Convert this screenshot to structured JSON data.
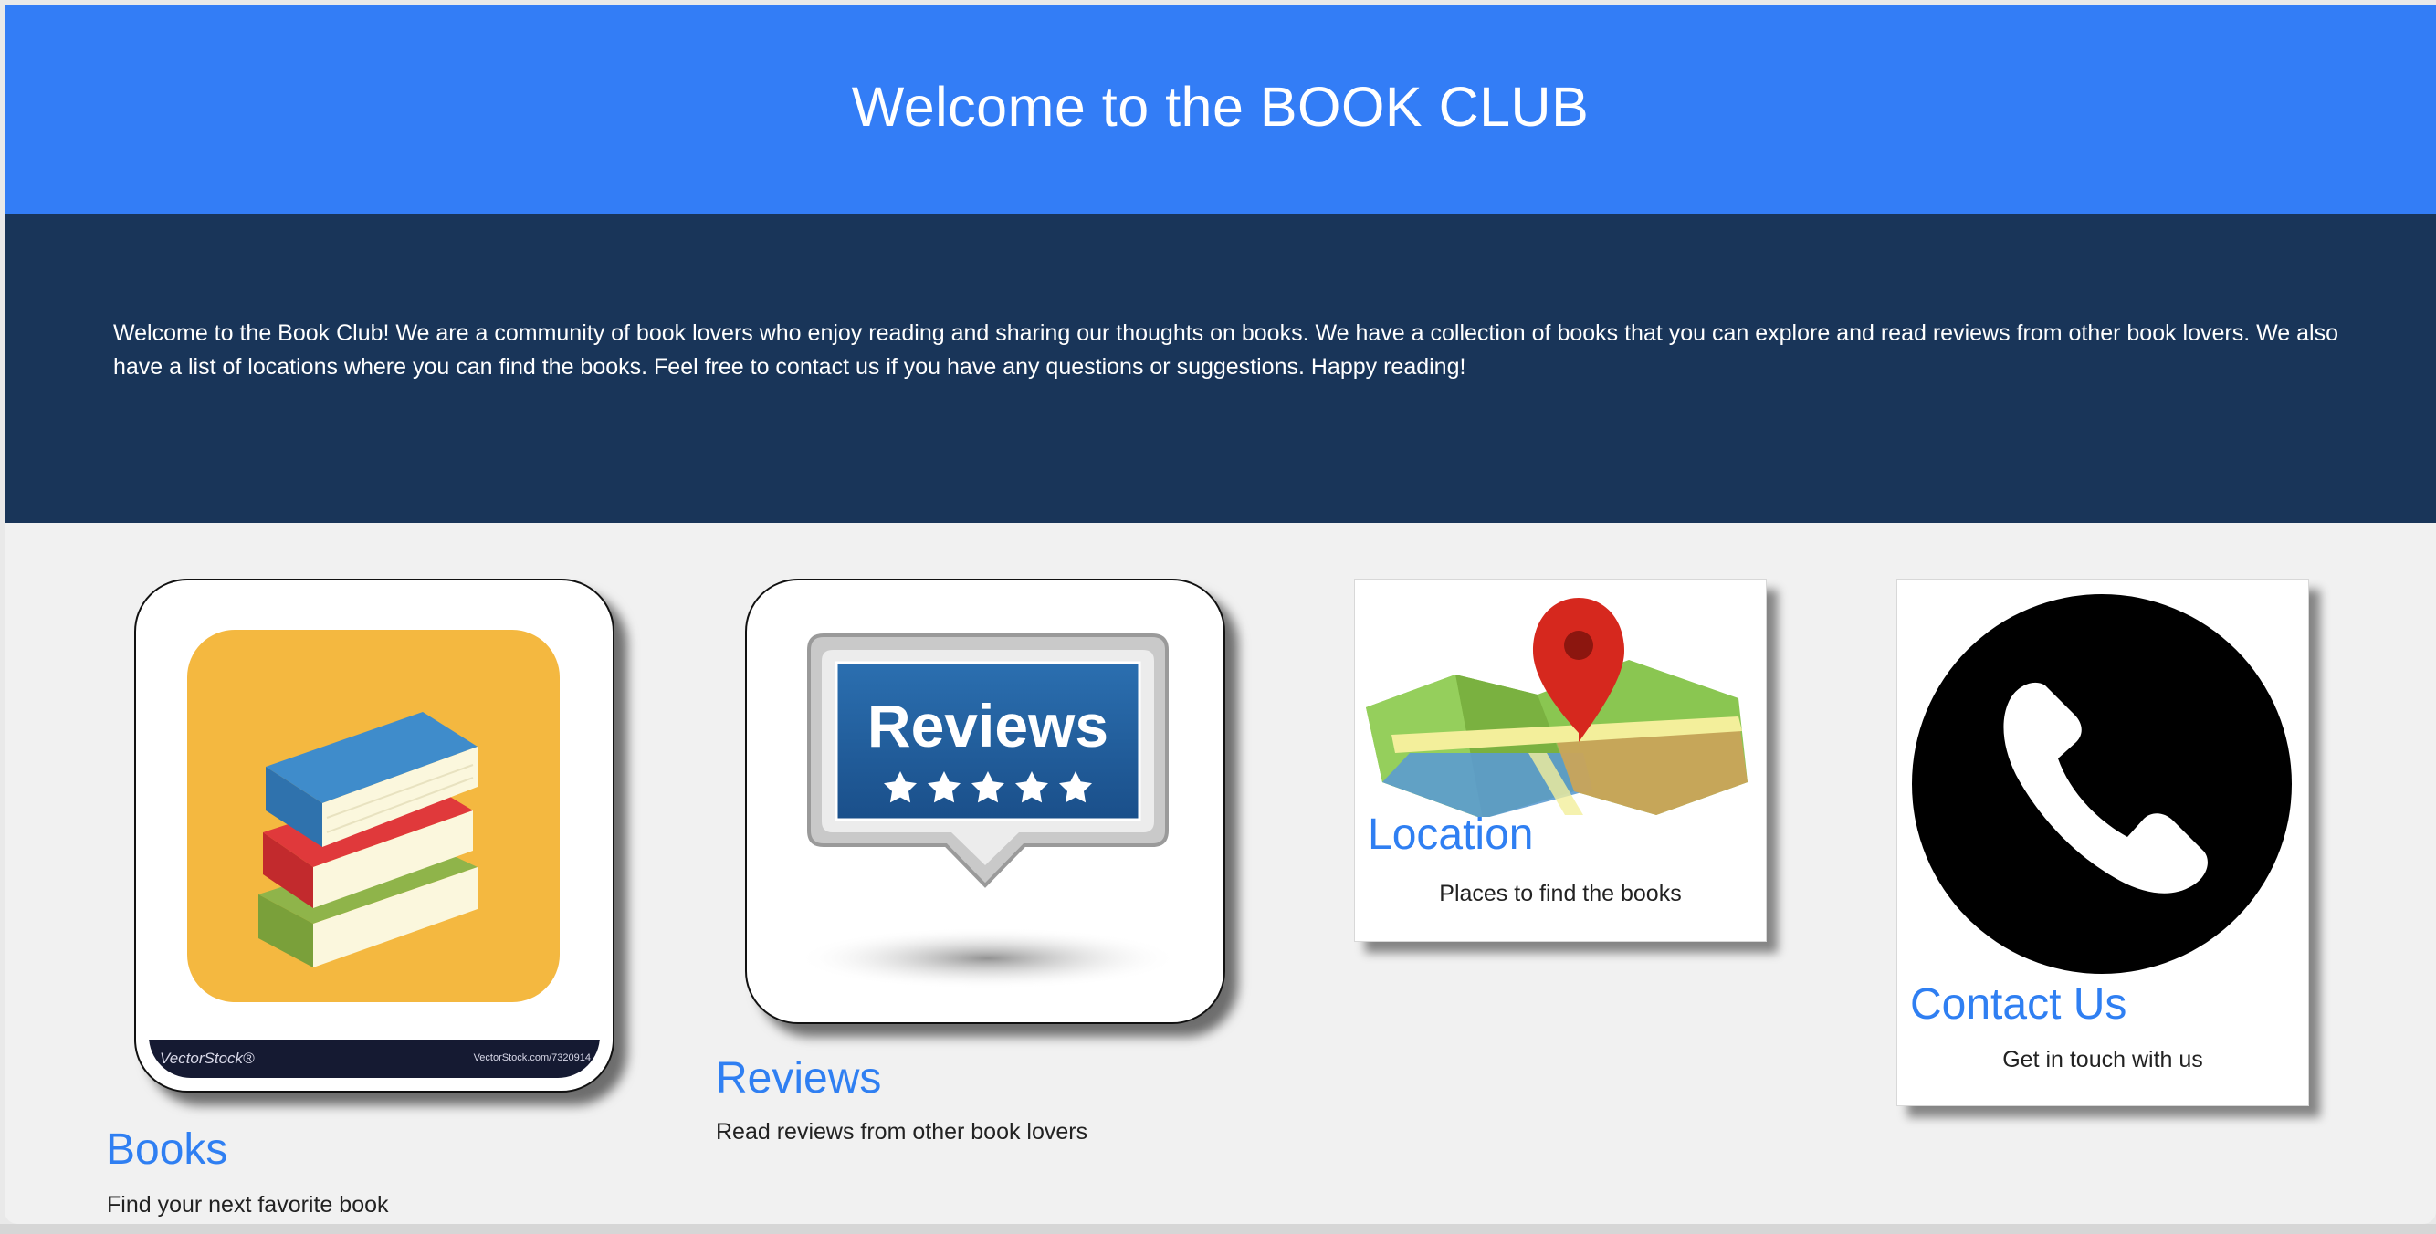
{
  "header": {
    "title": "Welcome to the BOOK CLUB"
  },
  "intro": {
    "text": "Welcome to the Book Club! We are a community of book lovers who enjoy reading and sharing our thoughts on books. We have a collection of books that you can explore and read reviews from other book lovers. We also have a list of locations where you can find the books. Feel free to contact us if you have any questions or suggestions. Happy reading!"
  },
  "cards": [
    {
      "title": "Books",
      "description": "Find your next favorite book",
      "icon": "books-stack-icon",
      "watermark_left": "VectorStock®",
      "watermark_right": "VectorStock.com/7320914"
    },
    {
      "title": "Reviews",
      "description": "Read reviews from other book lovers",
      "icon": "reviews-badge-icon",
      "badge_text": "Reviews"
    },
    {
      "title": "Location",
      "description": "Places to find the books",
      "icon": "map-pin-icon"
    },
    {
      "title": "Contact Us",
      "description": "Get in touch with us",
      "icon": "phone-icon"
    }
  ],
  "colors": {
    "header_bg": "#337df6",
    "intro_bg": "#193559",
    "page_bg": "#f1f1f1",
    "link_blue": "#2f7ff2"
  }
}
